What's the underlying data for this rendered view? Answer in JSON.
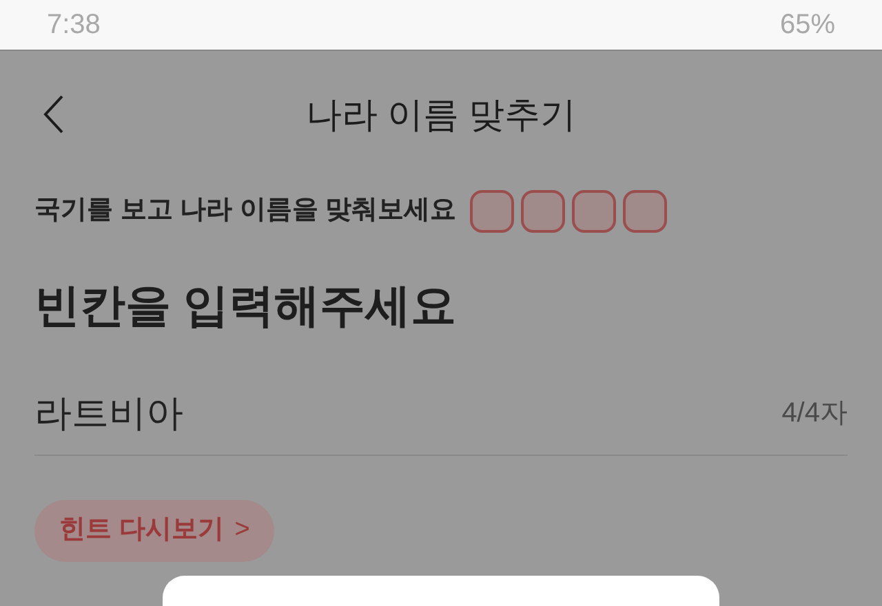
{
  "status_bar": {
    "time": "7:38",
    "battery": "65%"
  },
  "header": {
    "title": "나라 이름 맞추기"
  },
  "prompt": {
    "text": "국기를 보고 나라 이름을 맞춰보세요",
    "blanks": [
      {
        "kind": "empty"
      },
      {
        "kind": "empty"
      },
      {
        "kind": "empty"
      },
      {
        "kind": "empty"
      }
    ]
  },
  "heading": "빈칸을 입력해주세요",
  "answer": {
    "value": "라트비아",
    "counter": "4/4자"
  },
  "hint_button": {
    "label": "힌트 다시보기",
    "icon": ">"
  },
  "dialog": {
    "visible": true
  }
}
